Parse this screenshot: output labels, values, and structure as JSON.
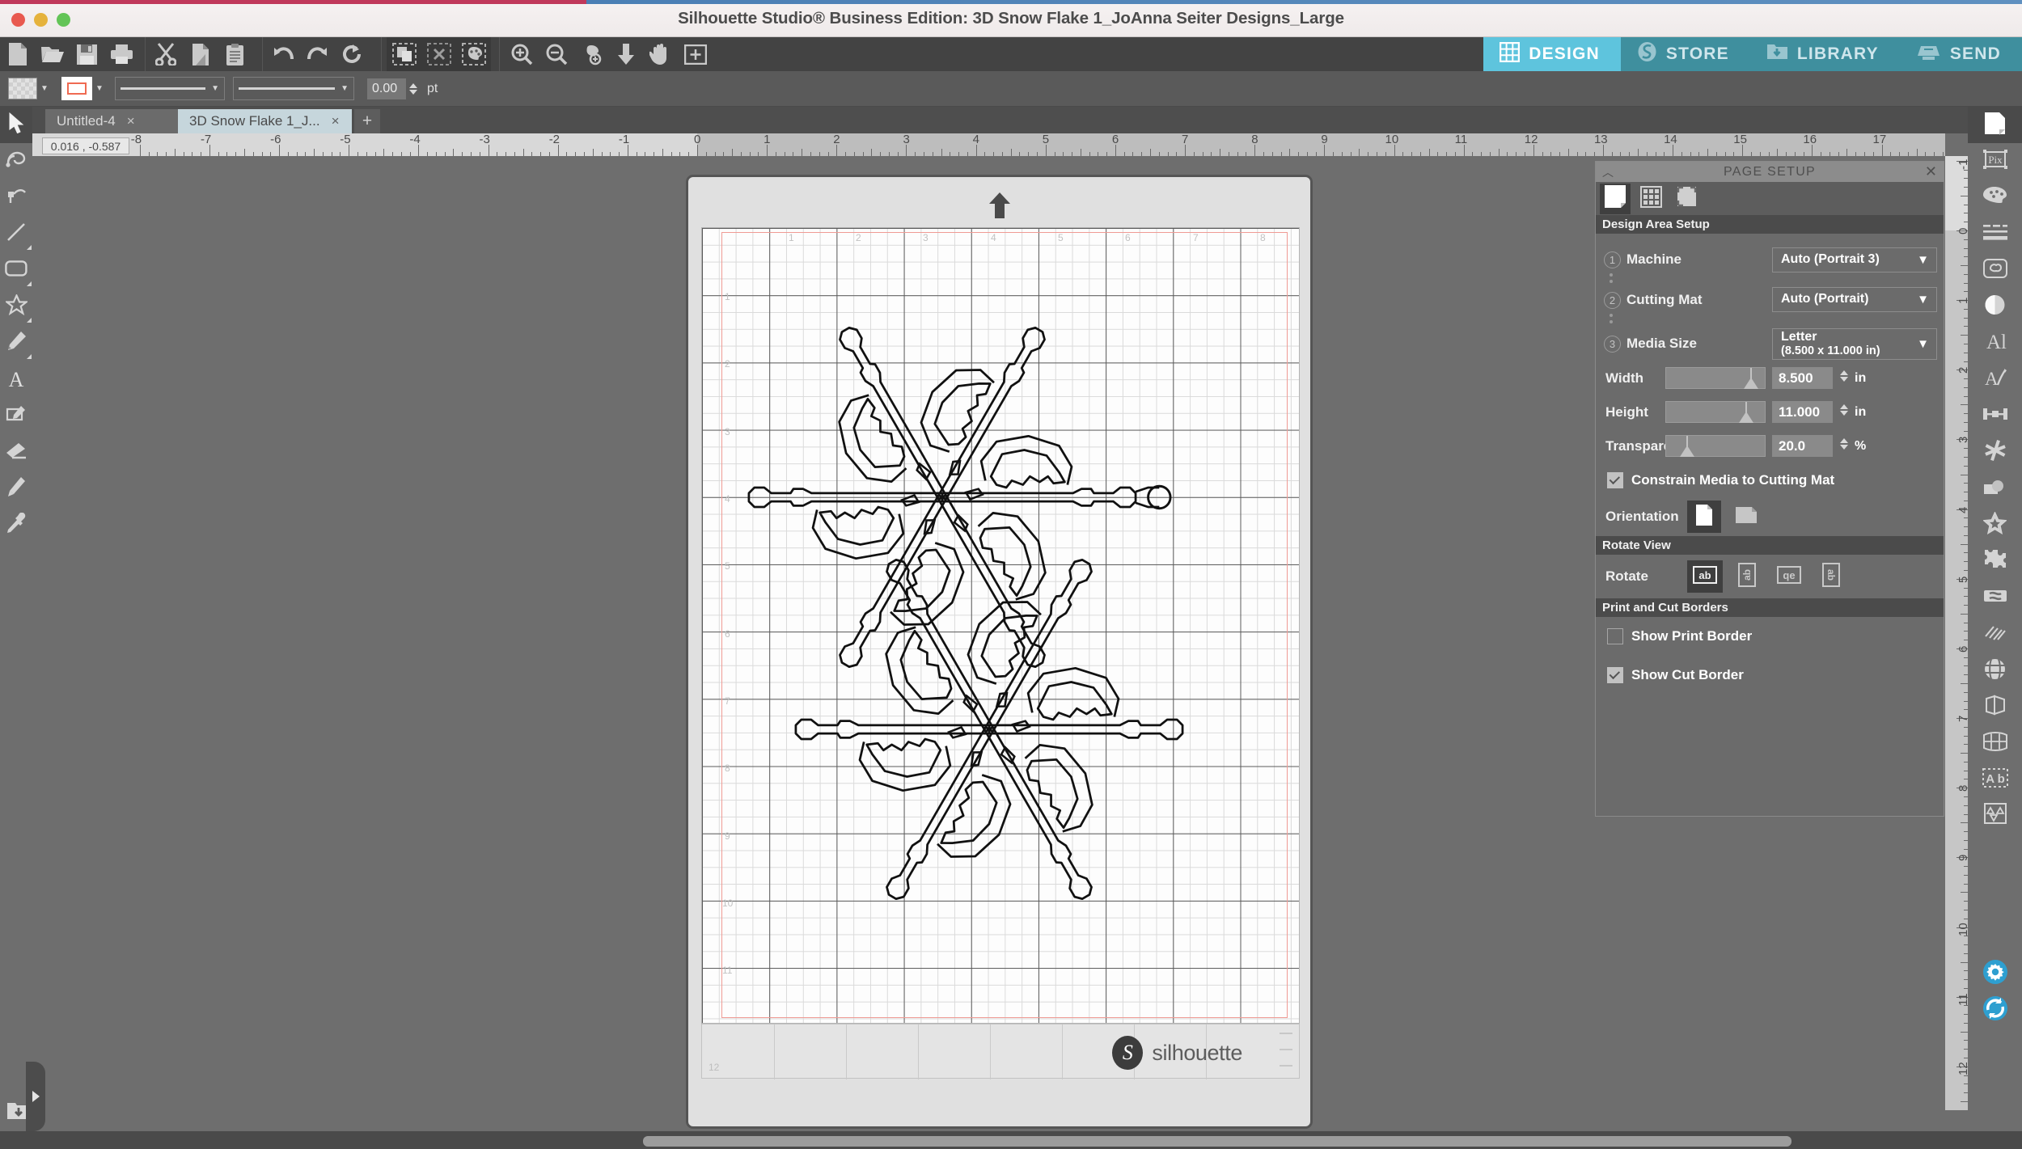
{
  "window": {
    "title": "Silhouette Studio® Business Edition: 3D Snow Flake 1_JoAnna Seiter Designs_Large",
    "traffic_lights": [
      "close",
      "minimize",
      "maximize"
    ]
  },
  "toolbar": {
    "groups": [
      {
        "name": "file",
        "items": [
          {
            "icon": "new-document-icon",
            "label": "New"
          },
          {
            "icon": "open-folder-icon",
            "label": "Open"
          },
          {
            "icon": "save-icon",
            "label": "Save"
          },
          {
            "icon": "print-icon",
            "label": "Print"
          }
        ]
      },
      {
        "name": "clipboard",
        "items": [
          {
            "icon": "scissors-cut-icon",
            "label": "Cut"
          },
          {
            "icon": "copy-icon",
            "label": "Copy"
          },
          {
            "icon": "paste-icon",
            "label": "Paste"
          }
        ]
      },
      {
        "name": "history",
        "items": [
          {
            "icon": "undo-arrow-icon",
            "label": "Undo"
          },
          {
            "icon": "redo-arrow-icon",
            "label": "Redo"
          },
          {
            "icon": "refresh-icon",
            "label": "Refresh"
          }
        ]
      },
      {
        "name": "select",
        "items": [
          {
            "icon": "select-duplicate-icon",
            "label": "Select Same Shape"
          },
          {
            "icon": "select-none-icon",
            "label": "Select None"
          },
          {
            "icon": "select-color-icon",
            "label": "Select Same Fill"
          }
        ]
      },
      {
        "name": "view",
        "items": [
          {
            "icon": "zoom-in-icon",
            "label": "Zoom In"
          },
          {
            "icon": "zoom-out-icon",
            "label": "Zoom Out"
          },
          {
            "icon": "zoom-selection-icon",
            "label": "Zoom to Selection"
          },
          {
            "icon": "fit-to-page-icon",
            "label": "Fit to Page"
          },
          {
            "icon": "pan-hand-icon",
            "label": "Pan"
          },
          {
            "icon": "fit-window-icon",
            "label": "Fit Window"
          }
        ]
      }
    ]
  },
  "nav_tabs": [
    {
      "label": "DESIGN",
      "icon": "grid-icon",
      "active": true
    },
    {
      "label": "STORE",
      "icon": "store-s-icon",
      "active": false
    },
    {
      "label": "LIBRARY",
      "icon": "library-folder-icon",
      "active": false
    },
    {
      "label": "SEND",
      "icon": "cutter-machine-icon",
      "active": false
    }
  ],
  "stylebar": {
    "fill_swatch": "transparent-checker",
    "line_swatch_color": "#ef6a52",
    "line_style_placeholder": "solid-line",
    "line_width_placeholder": "solid-line",
    "thickness_value": "0.00",
    "thickness_unit": "pt"
  },
  "left_tools": [
    {
      "icon": "select-arrow-icon",
      "label": "Select",
      "selected": true
    },
    {
      "icon": "edit-points-icon",
      "label": "Edit Points",
      "selected": false
    },
    {
      "icon": "knife-icon",
      "label": "Knife",
      "selected": false
    },
    {
      "icon": "line-tool-icon",
      "label": "Draw a Line",
      "selected": false,
      "has_submenu": true
    },
    {
      "icon": "rectangle-tool-icon",
      "label": "Draw a Rectangle",
      "selected": false,
      "has_submenu": true
    },
    {
      "icon": "polygon-star-tool-icon",
      "label": "Draw a Polygon",
      "selected": false,
      "has_submenu": true
    },
    {
      "icon": "pencil-tool-icon",
      "label": "Draw Freehand",
      "selected": false,
      "has_submenu": true
    },
    {
      "icon": "text-tool-icon",
      "label": "Text",
      "selected": false
    },
    {
      "icon": "trace-tool-icon",
      "label": "Trace",
      "selected": false
    },
    {
      "icon": "eraser-tool-icon",
      "label": "Eraser",
      "selected": false
    },
    {
      "icon": "marker-tool-icon",
      "label": "Marker",
      "selected": false
    },
    {
      "icon": "eyedropper-tool-icon",
      "label": "Eyedropper",
      "selected": false
    }
  ],
  "tabs": {
    "documents": [
      {
        "label": "Untitled-4",
        "active": false,
        "closable": true
      },
      {
        "label": "3D Snow Flake 1_J...",
        "active": true,
        "closable": true
      }
    ],
    "add_label": "+"
  },
  "rulers": {
    "coord_readout": "0.016 , -0.587",
    "horizontal_ticks": [
      "-8",
      "-7",
      "-6",
      "-5",
      "-4",
      "-3",
      "-2",
      "-1",
      "0",
      "1",
      "2",
      "3",
      "4",
      "5",
      "6",
      "7",
      "8",
      "9",
      "10",
      "11",
      "12",
      "13",
      "14",
      "15",
      "16",
      "17"
    ],
    "vertical_ticks": [
      "-1",
      "0",
      "1",
      "2",
      "3",
      "4",
      "5",
      "6",
      "7",
      "8",
      "9",
      "10",
      "11",
      "12"
    ],
    "unit": "in"
  },
  "canvas": {
    "mat_label": "cutting-mat",
    "orientation_arrow": "up-arrow",
    "grid_numbers_h": [
      "1",
      "2",
      "3",
      "4",
      "5",
      "6",
      "7",
      "8"
    ],
    "grid_numbers_v": [
      "1",
      "2",
      "3",
      "4",
      "5",
      "6",
      "7",
      "8",
      "9",
      "10",
      "11"
    ],
    "footer_number": "12",
    "brand_text": "silhouette",
    "brand_mark": "S",
    "cut_border_color": "#f09b95",
    "design_name": "3D Snow Flake"
  },
  "panel": {
    "title": "PAGE SETUP",
    "collapse_icon": "chevron-up-icon",
    "close_icon": "close-x-icon",
    "tabs": [
      {
        "icon": "page-icon",
        "label": "Page",
        "selected": true
      },
      {
        "icon": "grid-panel-icon",
        "label": "Grid",
        "selected": false
      },
      {
        "icon": "registration-marks-icon",
        "label": "Registration Marks",
        "selected": false
      }
    ],
    "section_design_area": "Design Area Setup",
    "machine": {
      "step": "1",
      "label": "Machine",
      "value": "Auto (Portrait 3)"
    },
    "cutting_mat": {
      "step": "2",
      "label": "Cutting Mat",
      "value": "Auto (Portrait)"
    },
    "media_size": {
      "step": "3",
      "label": "Media Size",
      "value": "Letter",
      "value_sub": "(8.500 x 11.000 in)"
    },
    "width": {
      "label": "Width",
      "value": "8.500",
      "unit": "in",
      "slider_pct": 86
    },
    "height": {
      "label": "Height",
      "value": "11.000",
      "unit": "in",
      "slider_pct": 82
    },
    "transparency": {
      "label": "Transparency",
      "value": "20.0",
      "unit": "%",
      "slider_pct": 20
    },
    "constrain": {
      "label": "Constrain Media to Cutting Mat",
      "checked": true
    },
    "orientation": {
      "label": "Orientation",
      "options": [
        {
          "icon": "portrait-page-icon",
          "selected": true
        },
        {
          "icon": "landscape-page-icon",
          "selected": false
        }
      ]
    },
    "section_rotate_view": "Rotate View",
    "rotate": {
      "label": "Rotate",
      "options": [
        {
          "icon": "rotate-0-icon",
          "glyph": "ab",
          "selected": true
        },
        {
          "icon": "rotate-90-icon",
          "glyph": "ab",
          "selected": false
        },
        {
          "icon": "rotate-180-icon",
          "glyph": "qe",
          "selected": false
        },
        {
          "icon": "rotate-270-icon",
          "glyph": "ab",
          "selected": false
        }
      ]
    },
    "section_print_cut": "Print and Cut Borders",
    "show_print_border": {
      "label": "Show Print Border",
      "checked": false
    },
    "show_cut_border": {
      "label": "Show Cut Border",
      "checked": true
    }
  },
  "right_tools": [
    {
      "icon": "page-setup-icon",
      "label": "Page Setup",
      "selected": true
    },
    {
      "icon": "pixscan-icon",
      "label": "PixScan"
    },
    {
      "icon": "fill-palette-icon",
      "label": "Fill"
    },
    {
      "icon": "line-style-icon",
      "label": "Line Style"
    },
    {
      "icon": "sketch-icon",
      "label": "Sketch"
    },
    {
      "icon": "shadow-icon",
      "label": "Shadow"
    },
    {
      "icon": "text-style-icon",
      "label": "Text Style"
    },
    {
      "icon": "font-effects-icon",
      "label": "Font Effects"
    },
    {
      "icon": "align-icon",
      "label": "Align"
    },
    {
      "icon": "transform-icon",
      "label": "Transform"
    },
    {
      "icon": "replicate-icon",
      "label": "Replicate"
    },
    {
      "icon": "offset-star-icon",
      "label": "Offset"
    },
    {
      "icon": "modify-puzzle-icon",
      "label": "Modify"
    },
    {
      "icon": "weld-icon",
      "label": "Weld"
    },
    {
      "icon": "sketch-fill-icon",
      "label": "Sketch Fill"
    },
    {
      "icon": "warp-grid-icon",
      "label": "Warp"
    },
    {
      "icon": "3d-icon",
      "label": "3D"
    },
    {
      "icon": "conical-warp-icon",
      "label": "Conical Warp"
    },
    {
      "icon": "trace-text-icon",
      "label": "Auto Trace"
    },
    {
      "icon": "nesting-icon",
      "label": "Nesting"
    },
    {
      "icon": "settings-gear-icon",
      "label": "Preferences"
    },
    {
      "icon": "sync-library-icon",
      "label": "Sync"
    }
  ],
  "bottom": {
    "library_button_icon": "library-download-icon",
    "expand_panel_icon": "chevron-right-icon"
  }
}
